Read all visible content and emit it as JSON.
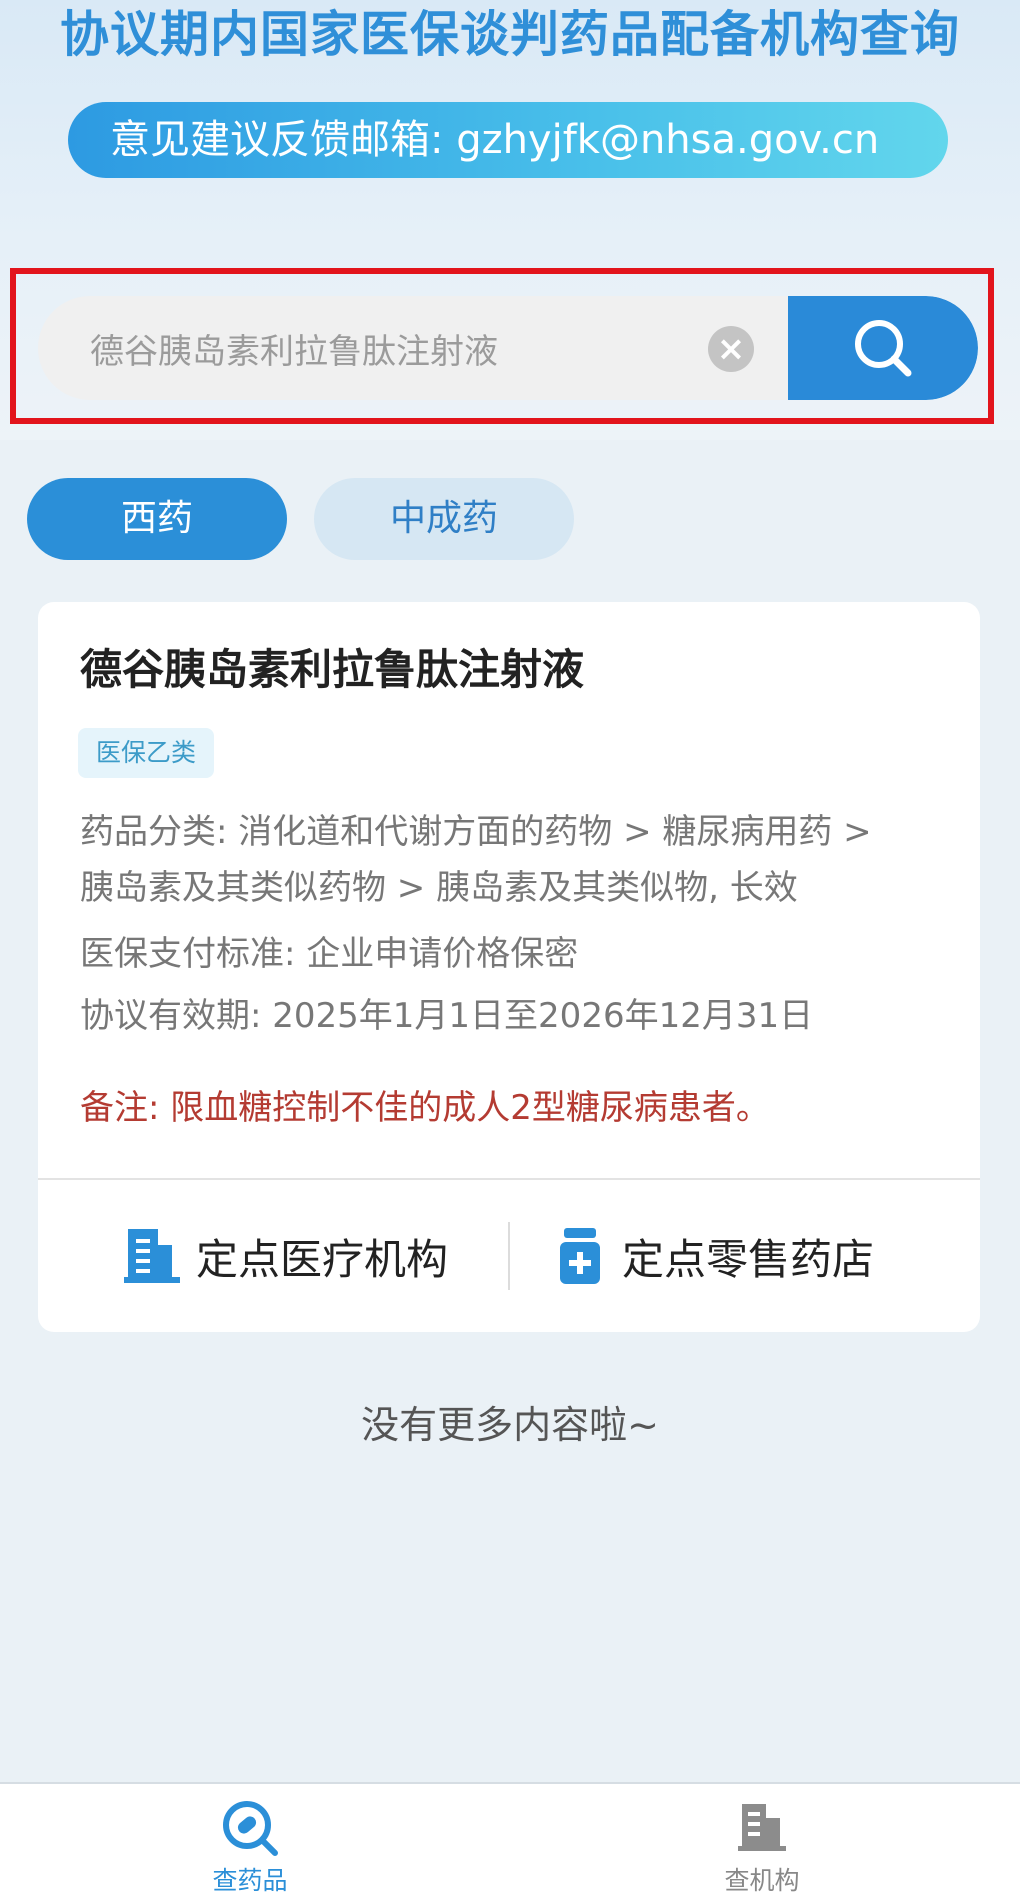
{
  "header": {
    "title": "协议期内国家医保谈判药品配备机构查询",
    "feedback": "意见建议反馈邮箱: gzhyjfk@nhsa.gov.cn"
  },
  "search": {
    "value": "德谷胰岛素利拉鲁肽注射液",
    "clear_icon": "clear-icon",
    "search_icon": "search-icon"
  },
  "tabs": [
    {
      "label": "西药",
      "active": true
    },
    {
      "label": "中成药",
      "active": false
    }
  ],
  "drug": {
    "name": "德谷胰岛素利拉鲁肽注射液",
    "badge": "医保乙类",
    "category_line1": "药品分类: 消化道和代谢方面的药物 > 糖尿病用药 >",
    "category_line2": "胰岛素及其类似药物 > 胰岛素及其类似物, 长效",
    "payment_standard": "医保支付标准: 企业申请价格保密",
    "validity": "协议有效期: 2025年1月1日至2026年12月31日",
    "remark": "备注: 限血糖控制不佳的成人2型糖尿病患者。",
    "actions": [
      {
        "label": "定点医疗机构",
        "icon": "hospital-building-icon"
      },
      {
        "label": "定点零售药店",
        "icon": "medicine-bottle-icon"
      }
    ]
  },
  "list_end": "没有更多内容啦~",
  "bottom_nav": [
    {
      "label": "查药品",
      "icon": "pill-search-icon",
      "active": true
    },
    {
      "label": "查机构",
      "icon": "building-icon",
      "active": false
    }
  ],
  "colors": {
    "primary": "#2b8fd8",
    "highlight_border": "#e2141c",
    "remark_text": "#b43b32"
  }
}
